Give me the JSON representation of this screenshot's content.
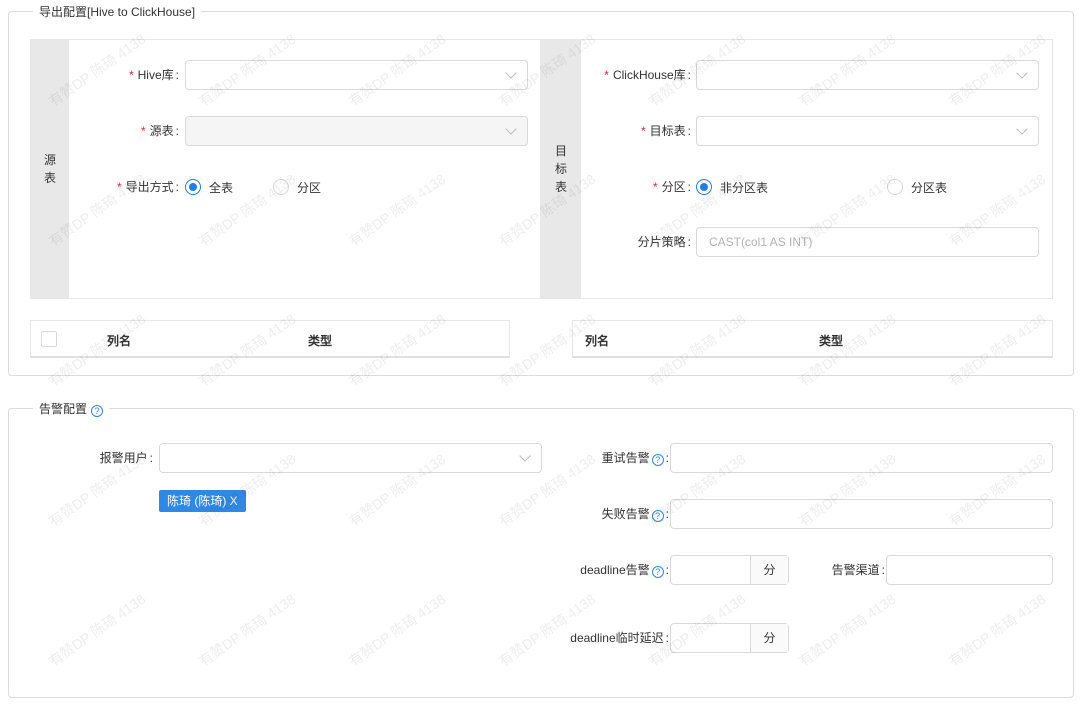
{
  "export": {
    "legend": "导出配置[Hive to ClickHouse]",
    "source": {
      "side_label": [
        "源",
        "表"
      ],
      "hive_db_label": "Hive库",
      "source_table_label": "源表",
      "export_mode_label": "导出方式",
      "export_mode_options": [
        {
          "label": "全表",
          "checked": true
        },
        {
          "label": "分区",
          "checked": false
        }
      ]
    },
    "target": {
      "side_label": [
        "目",
        "标",
        "表"
      ],
      "ck_db_label": "ClickHouse库",
      "target_table_label": "目标表",
      "partition_label": "分区",
      "partition_options": [
        {
          "label": "非分区表",
          "checked": true
        },
        {
          "label": "分区表",
          "checked": false
        }
      ],
      "shard_label": "分片策略",
      "shard_placeholder": "CAST(col1 AS INT)"
    },
    "source_table_headers": [
      "列名",
      "类型"
    ],
    "target_table_headers": [
      "列名",
      "类型"
    ]
  },
  "alert": {
    "legend": "告警配置",
    "help_icon": "question-circle-icon",
    "alert_users_label": "报警用户",
    "selected_user_tag": "陈琦 (陈琦) X",
    "retry_label": "重试告警",
    "failure_label": "失败告警",
    "deadline_label": "deadline告警",
    "deadline_unit": "分",
    "channel_label": "告警渠道",
    "delay_label": "deadline临时延迟",
    "delay_unit": "分"
  },
  "watermark_text": "有赞DP 陈琦 4138",
  "colors": {
    "accent": "#1f7ee8",
    "tag_bg": "#2f88e4",
    "required": "#f5222d",
    "side_bg": "#e8e8e8"
  }
}
